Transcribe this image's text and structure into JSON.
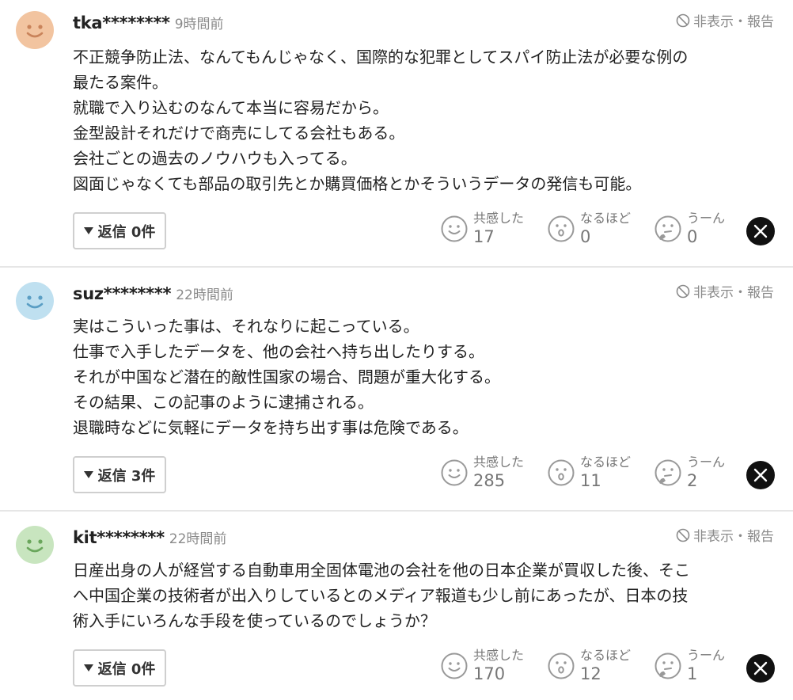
{
  "hide_report_label": "非表示・報告",
  "reaction_labels": {
    "empathy": "共感した",
    "insightful": "なるほど",
    "hmm": "うーん"
  },
  "colors": {
    "avatar_orange": "#f2c4a0",
    "avatar_blue": "#bfe0f0",
    "avatar_green": "#c8e5bf",
    "x_button": "#111111"
  },
  "comments": [
    {
      "user": "tka********",
      "time": "9時間前",
      "avatar_icon": "smiley-avatar-orange",
      "lines": [
        "不正競争防止法、なんてもんじゃなく、国際的な犯罪としてスパイ防止法が必要な例の",
        "最たる案件。",
        "就職で入り込むのなんて本当に容易だから。",
        "金型設計それだけで商売にしてる会社もある。",
        "会社ごとの過去のノウハウも入ってる。",
        "図面じゃなくても部品の取引先とか購買価格とかそういうデータの発信も可能。"
      ],
      "reply_label": "返信 0件",
      "reactions": {
        "empathy": "17",
        "insightful": "0",
        "hmm": "0"
      }
    },
    {
      "user": "suz********",
      "time": "22時間前",
      "avatar_icon": "smiley-avatar-blue",
      "lines": [
        "実はこういった事は、それなりに起こっている。",
        "仕事で入手したデータを、他の会社へ持ち出したりする。",
        "それが中国など潜在的敵性国家の場合、問題が重大化する。",
        "その結果、この記事のように逮捕される。",
        "退職時などに気軽にデータを持ち出す事は危険である。"
      ],
      "reply_label": "返信 3件",
      "reactions": {
        "empathy": "285",
        "insightful": "11",
        "hmm": "2"
      }
    },
    {
      "user": "kit********",
      "time": "22時間前",
      "avatar_icon": "smiley-avatar-green",
      "lines": [
        "日産出身の人が経営する自動車用全固体電池の会社を他の日本企業が買収した後、そこ",
        "へ中国企業の技術者が出入りしているとのメディア報道も少し前にあったが、日本の技",
        "術入手にいろんな手段を使っているのでしょうか？"
      ],
      "reply_label": "返信 0件",
      "reactions": {
        "empathy": "170",
        "insightful": "12",
        "hmm": "1"
      }
    }
  ]
}
